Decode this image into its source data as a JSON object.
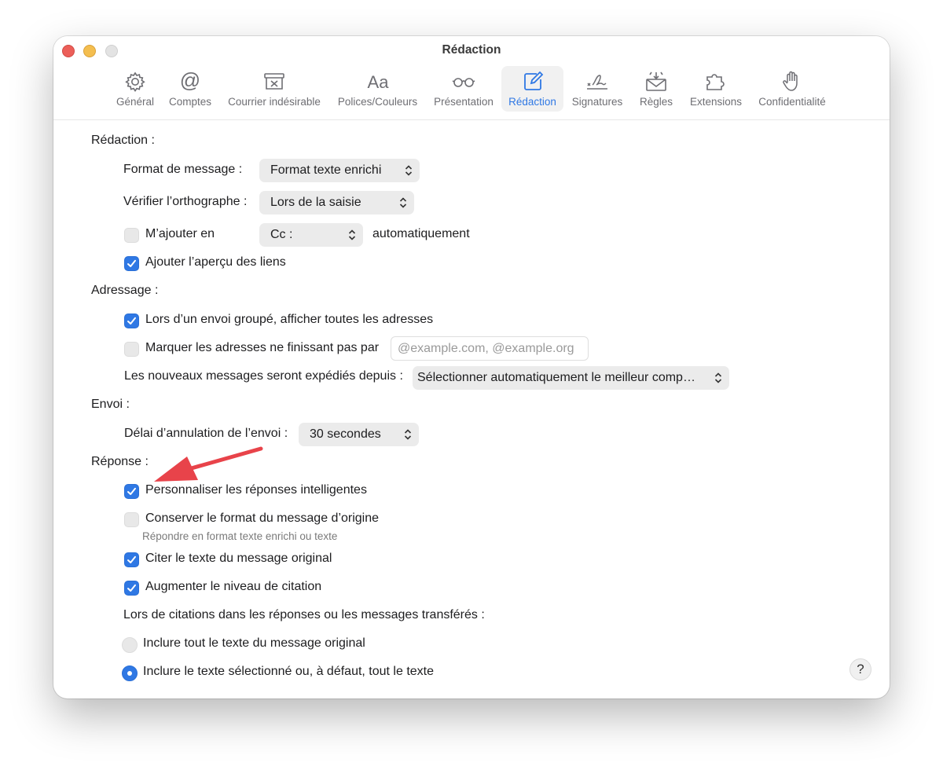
{
  "window": {
    "title": "Rédaction"
  },
  "toolbar": {
    "items": [
      {
        "label": "Général",
        "icon": "gear-icon"
      },
      {
        "label": "Comptes",
        "icon": "at-icon"
      },
      {
        "label": "Courrier indésirable",
        "icon": "junk-box-icon"
      },
      {
        "label": "Polices/Couleurs",
        "icon": "font-aa-icon"
      },
      {
        "label": "Présentation",
        "icon": "glasses-icon"
      },
      {
        "label": "Rédaction",
        "icon": "compose-icon",
        "active": true
      },
      {
        "label": "Signatures",
        "icon": "signature-icon"
      },
      {
        "label": "Règles",
        "icon": "envelope-rules-icon"
      },
      {
        "label": "Extensions",
        "icon": "puzzle-icon"
      },
      {
        "label": "Confidentialité",
        "icon": "hand-icon"
      }
    ]
  },
  "redaction": {
    "heading": "Rédaction :",
    "format_label": "Format de message :",
    "format_value": "Format texte enrichi",
    "spelling_label": "Vérifier l’orthographe :",
    "spelling_value": "Lors de la saisie",
    "add_me_label": "M’ajouter en",
    "add_me_checked": false,
    "add_me_value": "Cc :",
    "add_me_suffix": "automatiquement",
    "link_preview_label": "Ajouter l’aperçu des liens",
    "link_preview_checked": true
  },
  "adressage": {
    "heading": "Adressage :",
    "show_all_label": "Lors d’un envoi groupé, afficher toutes les adresses",
    "show_all_checked": true,
    "mark_label": "Marquer les adresses ne finissant pas par",
    "mark_checked": false,
    "mark_placeholder": "@example.com, @example.org",
    "send_from_label": "Les nouveaux messages seront expédiés depuis :",
    "send_from_value": "Sélectionner automatiquement le meilleur comp…"
  },
  "envoi": {
    "heading": "Envoi :",
    "undo_label": "Délai d’annulation de l’envoi :",
    "undo_value": "30 secondes"
  },
  "reponse": {
    "heading": "Réponse :",
    "smart_label": "Personnaliser les réponses intelligentes",
    "smart_checked": true,
    "keep_format_label": "Conserver le format du message d’origine",
    "keep_format_checked": false,
    "keep_format_sub": "Répondre en format texte enrichi ou texte",
    "quote_label": "Citer le texte du message original",
    "quote_checked": true,
    "increase_label": "Augmenter le niveau de citation",
    "increase_checked": true,
    "when_quoting_label": "Lors de citations dans les réponses ou les messages transférés :",
    "include_all_label": "Inclure tout le texte du message original",
    "include_all_selected": false,
    "include_selected_label": "Inclure le texte sélectionné ou, à défaut, tout le texte",
    "include_selected_selected": true
  },
  "help_label": "?",
  "colors": {
    "accent": "#2f78e4",
    "annotation_arrow": "#e8434a"
  }
}
